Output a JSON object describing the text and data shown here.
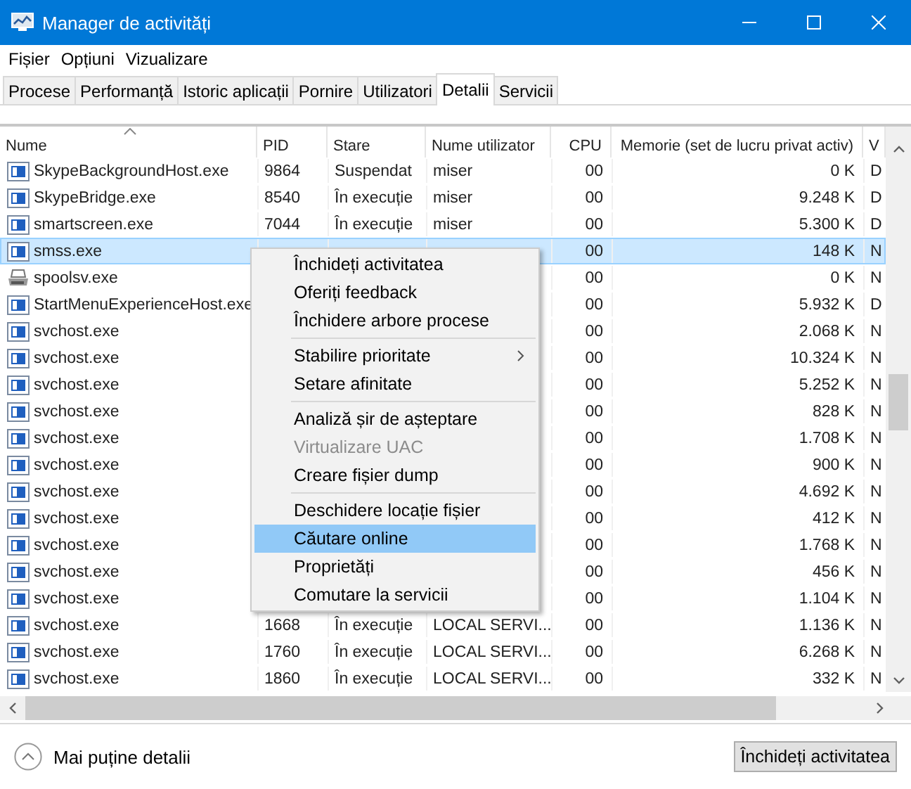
{
  "window": {
    "title": "Manager de activități"
  },
  "menu_bar": [
    "Fișier",
    "Opțiuni",
    "Vizualizare"
  ],
  "tabs": [
    {
      "label": "Procese",
      "selected": false
    },
    {
      "label": "Performanță",
      "selected": false
    },
    {
      "label": "Istoric aplicații",
      "selected": false
    },
    {
      "label": "Pornire",
      "selected": false
    },
    {
      "label": "Utilizatori",
      "selected": false
    },
    {
      "label": "Detalii",
      "selected": true
    },
    {
      "label": "Servicii",
      "selected": false
    }
  ],
  "table": {
    "columns": [
      "Nume",
      "PID",
      "Stare",
      "Nume utilizator",
      "CPU",
      "Memorie (set de lucru privat activ)",
      "V"
    ],
    "rows": [
      {
        "kind": "app",
        "selected": false,
        "cells": [
          "SkypeBackgroundHost.exe",
          "9864",
          "Suspendat",
          "miser",
          "00",
          "0 K",
          "D"
        ]
      },
      {
        "kind": "app",
        "selected": false,
        "cells": [
          "SkypeBridge.exe",
          "8540",
          "În execuție",
          "miser",
          "00",
          "9.248 K",
          "D"
        ]
      },
      {
        "kind": "app",
        "selected": false,
        "cells": [
          "smartscreen.exe",
          "7044",
          "În execuție",
          "miser",
          "00",
          "5.300 K",
          "D"
        ]
      },
      {
        "kind": "app",
        "selected": true,
        "cells": [
          "smss.exe",
          null,
          null,
          null,
          "00",
          "148 K",
          "N"
        ]
      },
      {
        "kind": "printer",
        "selected": false,
        "cells": [
          "spoolsv.exe",
          null,
          null,
          null,
          "00",
          "0 K",
          "N"
        ]
      },
      {
        "kind": "app",
        "selected": false,
        "cells": [
          "StartMenuExperienceHost.exe",
          null,
          null,
          null,
          "00",
          "5.932 K",
          "D"
        ]
      },
      {
        "kind": "app",
        "selected": false,
        "cells": [
          "svchost.exe",
          null,
          null,
          null,
          "00",
          "2.068 K",
          "N"
        ]
      },
      {
        "kind": "app",
        "selected": false,
        "cells": [
          "svchost.exe",
          null,
          null,
          null,
          "00",
          "10.324 K",
          "N"
        ]
      },
      {
        "kind": "app",
        "selected": false,
        "cells": [
          "svchost.exe",
          null,
          null,
          null,
          "00",
          "5.252 K",
          "N"
        ]
      },
      {
        "kind": "app",
        "selected": false,
        "cells": [
          "svchost.exe",
          null,
          null,
          null,
          "00",
          "828 K",
          "N"
        ]
      },
      {
        "kind": "app",
        "selected": false,
        "cells": [
          "svchost.exe",
          null,
          null,
          null,
          "00",
          "1.708 K",
          "N"
        ]
      },
      {
        "kind": "app",
        "selected": false,
        "cells": [
          "svchost.exe",
          null,
          null,
          null,
          "00",
          "900 K",
          "N"
        ]
      },
      {
        "kind": "app",
        "selected": false,
        "cells": [
          "svchost.exe",
          null,
          null,
          null,
          "00",
          "4.692 K",
          "N"
        ]
      },
      {
        "kind": "app",
        "selected": false,
        "cells": [
          "svchost.exe",
          null,
          null,
          null,
          "00",
          "412 K",
          "N"
        ]
      },
      {
        "kind": "app",
        "selected": false,
        "cells": [
          "svchost.exe",
          null,
          null,
          null,
          "00",
          "1.768 K",
          "N"
        ]
      },
      {
        "kind": "app",
        "selected": false,
        "cells": [
          "svchost.exe",
          null,
          null,
          null,
          "00",
          "456 K",
          "N"
        ]
      },
      {
        "kind": "app",
        "selected": false,
        "cells": [
          "svchost.exe",
          null,
          null,
          null,
          "00",
          "1.104 K",
          "N"
        ]
      },
      {
        "kind": "app",
        "selected": false,
        "cells": [
          "svchost.exe",
          "1668",
          "În execuție",
          "LOCAL SERVI...",
          "00",
          "1.136 K",
          "N"
        ]
      },
      {
        "kind": "app",
        "selected": false,
        "cells": [
          "svchost.exe",
          "1760",
          "În execuție",
          "LOCAL SERVI...",
          "00",
          "6.268 K",
          "N"
        ]
      },
      {
        "kind": "app",
        "selected": false,
        "cells": [
          "svchost.exe",
          "1860",
          "În execuție",
          "LOCAL SERVI...",
          "00",
          "332 K",
          "N"
        ]
      }
    ]
  },
  "context_menu": {
    "groups": [
      [
        {
          "label": "Închideți activitatea",
          "disabled": false,
          "selected": false,
          "submenu": false
        },
        {
          "label": "Oferiți feedback",
          "disabled": false,
          "selected": false,
          "submenu": false
        },
        {
          "label": "Închidere arbore procese",
          "disabled": false,
          "selected": false,
          "submenu": false
        }
      ],
      [
        {
          "label": "Stabilire prioritate",
          "disabled": false,
          "selected": false,
          "submenu": true
        },
        {
          "label": "Setare afinitate",
          "disabled": false,
          "selected": false,
          "submenu": false
        }
      ],
      [
        {
          "label": "Analiză șir de așteptare",
          "disabled": false,
          "selected": false,
          "submenu": false
        },
        {
          "label": "Virtualizare UAC",
          "disabled": true,
          "selected": false,
          "submenu": false
        },
        {
          "label": "Creare fișier dump",
          "disabled": false,
          "selected": false,
          "submenu": false
        }
      ],
      [
        {
          "label": "Deschidere locație fișier",
          "disabled": false,
          "selected": false,
          "submenu": false
        },
        {
          "label": "Căutare online",
          "disabled": false,
          "selected": true,
          "submenu": false
        },
        {
          "label": "Proprietăți",
          "disabled": false,
          "selected": false,
          "submenu": false
        },
        {
          "label": "Comutare la servicii",
          "disabled": false,
          "selected": false,
          "submenu": false
        }
      ]
    ]
  },
  "footer": {
    "toggle": "Mai puține detalii",
    "button": "Închideți activitatea"
  }
}
